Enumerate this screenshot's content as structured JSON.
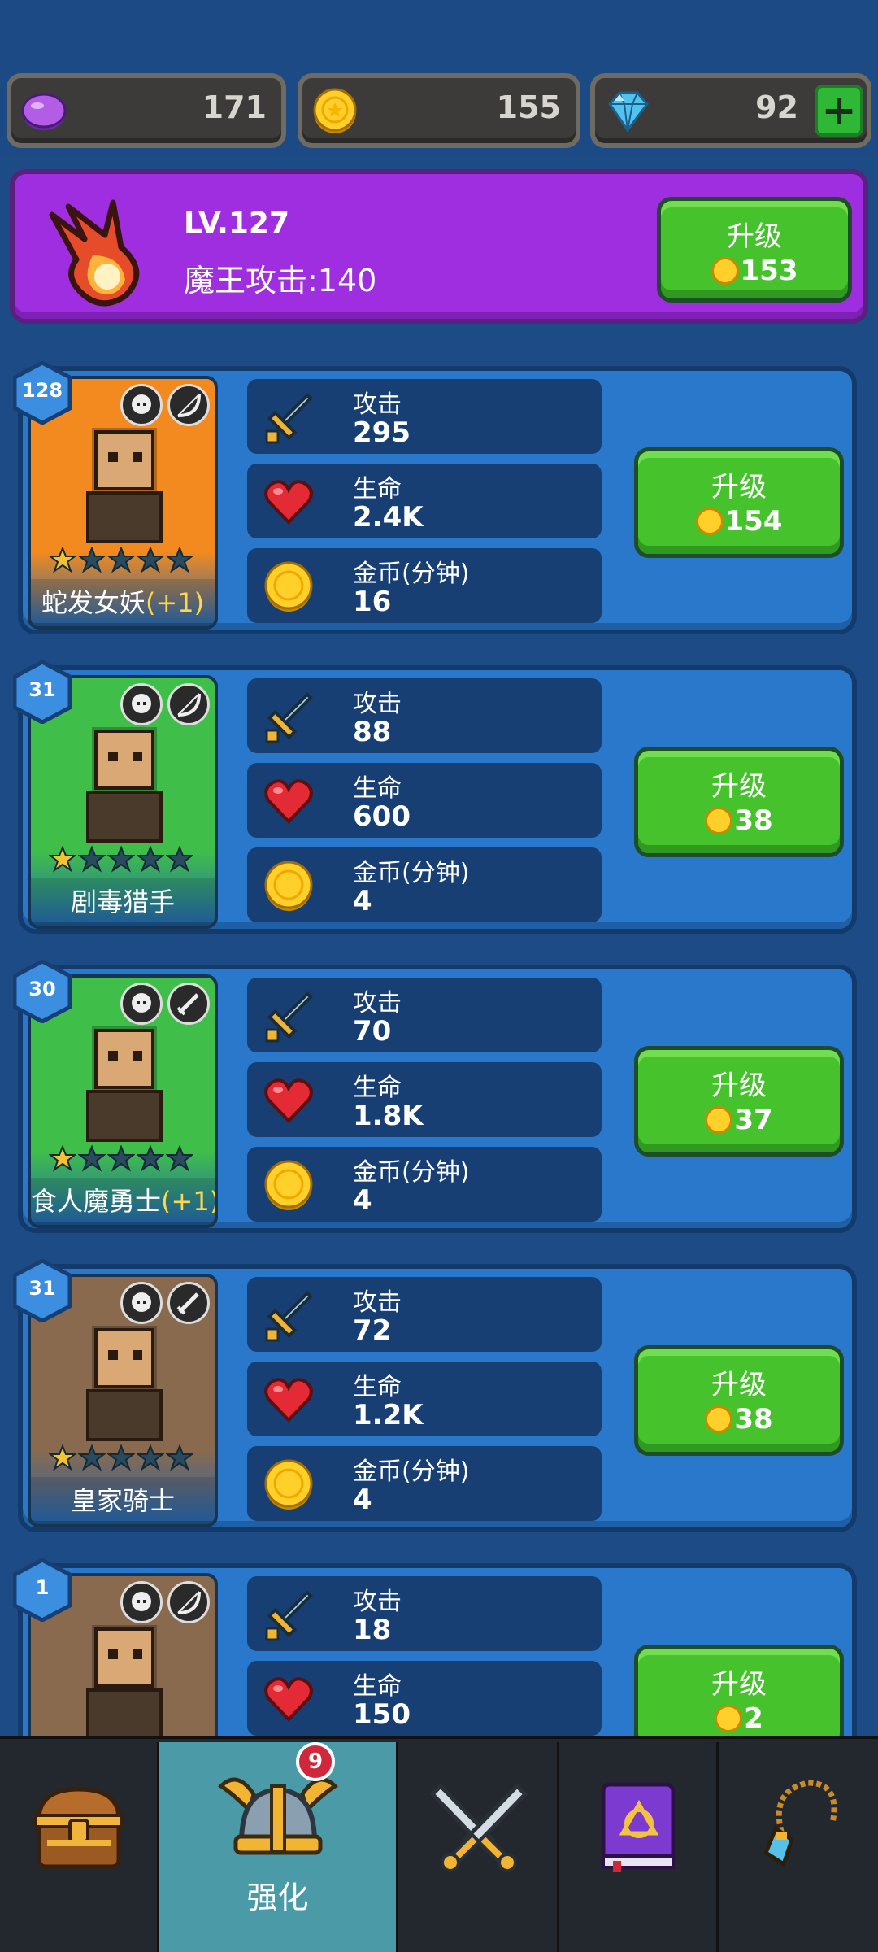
{
  "currencies": [
    {
      "name": "purple-gem",
      "value": "171"
    },
    {
      "name": "gold-coin",
      "value": "155"
    },
    {
      "name": "diamond",
      "value": "92"
    }
  ],
  "boss": {
    "level": "LV.127",
    "attack": "魔王攻击:140",
    "upgrade_label": "升级",
    "upgrade_cost": "153"
  },
  "heroes": [
    {
      "level": "128",
      "name": "蛇发女妖",
      "bonus": "(+1)",
      "stars": 1,
      "attack_label": "攻击",
      "attack": "295",
      "hp_label": "生命",
      "hp": "2.4K",
      "gold_label": "金币(分钟)",
      "gold": "16",
      "upgrade_label": "升级",
      "upgrade_cost": "154",
      "card_color": "#f28a1f"
    },
    {
      "level": "31",
      "name": "剧毒猎手",
      "bonus": "",
      "stars": 1,
      "attack_label": "攻击",
      "attack": "88",
      "hp_label": "生命",
      "hp": "600",
      "gold_label": "金币(分钟)",
      "gold": "4",
      "upgrade_label": "升级",
      "upgrade_cost": "38",
      "card_color": "#3fbf4a"
    },
    {
      "level": "30",
      "name": "食人魔勇士",
      "bonus": "(+1)",
      "stars": 1,
      "attack_label": "攻击",
      "attack": "70",
      "hp_label": "生命",
      "hp": "1.8K",
      "gold_label": "金币(分钟)",
      "gold": "4",
      "upgrade_label": "升级",
      "upgrade_cost": "37",
      "card_color": "#3fbf4a"
    },
    {
      "level": "31",
      "name": "皇家骑士",
      "bonus": "",
      "stars": 1,
      "attack_label": "攻击",
      "attack": "72",
      "hp_label": "生命",
      "hp": "1.2K",
      "gold_label": "金币(分钟)",
      "gold": "4",
      "upgrade_label": "升级",
      "upgrade_cost": "38",
      "card_color": "#8a6a4e"
    },
    {
      "level": "1",
      "name": "",
      "bonus": "",
      "stars": 0,
      "attack_label": "攻击",
      "attack": "18",
      "hp_label": "生命",
      "hp": "150",
      "gold_label": "",
      "gold": "",
      "upgrade_label": "升级",
      "upgrade_cost": "2",
      "card_color": "#8a6a4e"
    }
  ],
  "nav": {
    "items": [
      {
        "name": "treasure-chest",
        "label": ""
      },
      {
        "name": "upgrade-helmet",
        "label": "强化",
        "badge": "9"
      },
      {
        "name": "battle-swords",
        "label": ""
      },
      {
        "name": "spellbook",
        "label": ""
      },
      {
        "name": "amulet",
        "label": ""
      }
    ],
    "active_index": 1
  }
}
